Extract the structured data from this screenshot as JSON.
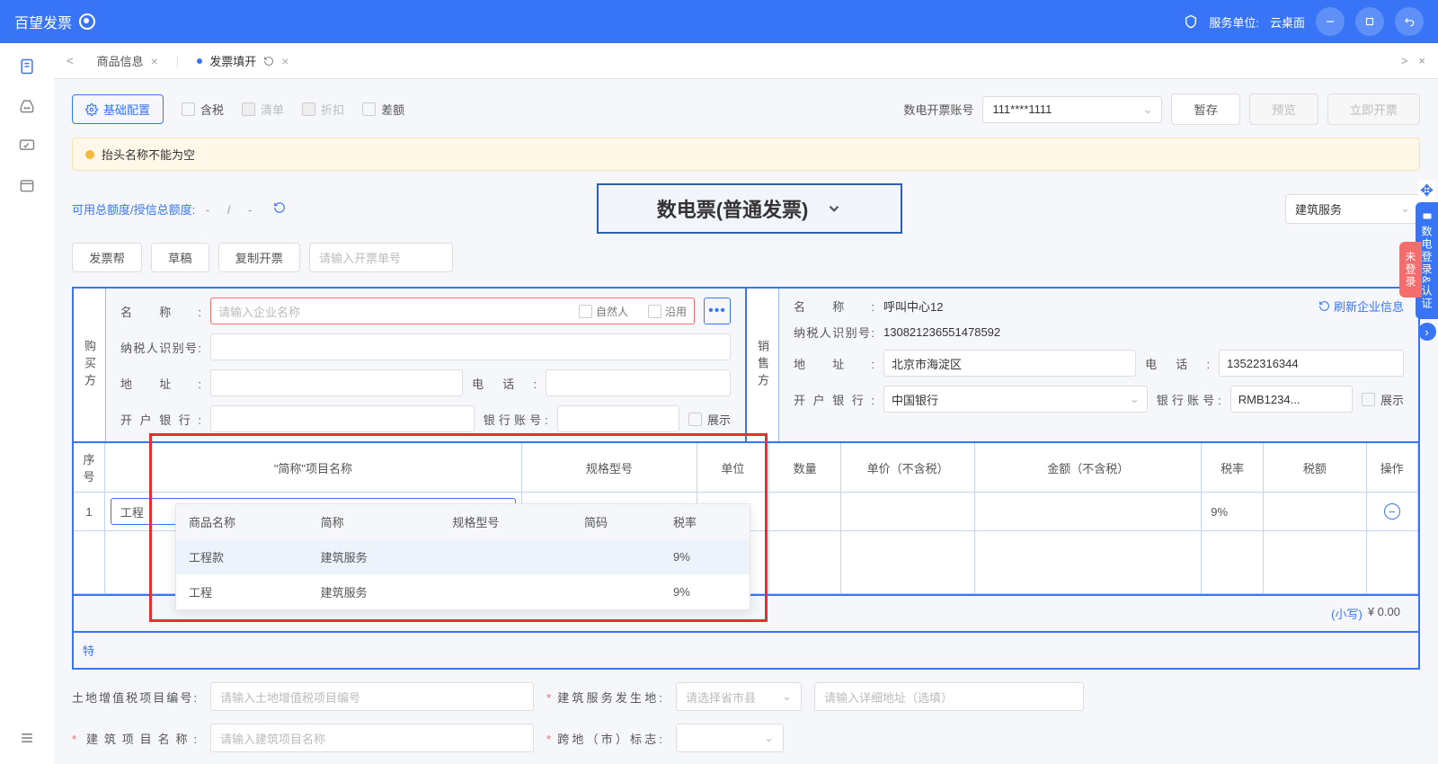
{
  "app": {
    "name": "百望发票",
    "service_unit_label": "服务单位:",
    "service_unit": "云桌面"
  },
  "tabs": [
    {
      "label": "商品信息",
      "active": false
    },
    {
      "label": "发票填开",
      "active": true
    }
  ],
  "toolbar": {
    "config": "基础配置",
    "tax_incl": "含税",
    "list": "清单",
    "discount": "折扣",
    "diff": "差额",
    "account_label": "数电开票账号",
    "account_value": "111****1111",
    "save": "暂存",
    "preview": "预览",
    "issue": "立即开票"
  },
  "warning": {
    "text": "抬头名称不能为空"
  },
  "quota": {
    "label": "可用总额度/授信总额度:",
    "v1": "-",
    "v2": "-"
  },
  "invoice_type": {
    "label": "数电票(普通发票)"
  },
  "category": {
    "value": "建筑服务"
  },
  "actions2": {
    "invoice_help": "发票帮",
    "draft": "草稿",
    "copy": "复制开票",
    "order_placeholder": "请输入开票单号"
  },
  "buyer": {
    "title": "购买方",
    "name_label": "名称:",
    "name_placeholder": "请输入企业名称",
    "natural": "自然人",
    "carry": "沿用",
    "tax_id_label": "纳税人识别号:",
    "address_label": "地址:",
    "phone_label": "电话:",
    "bank_label": "开户银行:",
    "bank_account_label": "银行账号:",
    "show": "展示"
  },
  "seller": {
    "title": "销售方",
    "name_label": "名称:",
    "name_value": "呼叫中心12",
    "refresh": "刷新企业信息",
    "tax_id_label": "纳税人识别号:",
    "tax_id_value": "130821236551478592",
    "address_label": "地址:",
    "address_value": "北京市海淀区",
    "phone_label": "电话:",
    "phone_value": "13522316344",
    "bank_label": "开户银行:",
    "bank_value": "中国银行",
    "bank_account_label": "银行账号:",
    "bank_account_value": "RMB1234...",
    "show": "展示"
  },
  "grid": {
    "headers": {
      "seq": "序号",
      "name": "\"简称\"项目名称",
      "spec": "规格型号",
      "unit": "单位",
      "qty": "数量",
      "price": "单价（不含税）",
      "amount": "金额（不含税）",
      "rate": "税率",
      "tax": "税额",
      "op": "操作"
    },
    "row": {
      "seq": "1",
      "name_input": "工程",
      "rate": "9%"
    },
    "totals": {
      "small": "(小写)",
      "value": "¥ 0.00"
    }
  },
  "dropdown": {
    "headers": {
      "name": "商品名称",
      "short": "简称",
      "spec": "规格型号",
      "code": "简码",
      "rate": "税率"
    },
    "rows": [
      {
        "name": "工程款",
        "short": "建筑服务",
        "spec": "",
        "code": "",
        "rate": "9%"
      },
      {
        "name": "工程",
        "short": "建筑服务",
        "spec": "",
        "code": "",
        "rate": "9%"
      }
    ]
  },
  "feature_prefix": "特",
  "extra": {
    "proj_code_label": "土地增值税项目编号:",
    "proj_code_placeholder": "请输入土地增值税项目编号",
    "service_loc_label": "建筑服务发生地:",
    "service_loc_placeholder": "请选择省市县",
    "detail_addr_placeholder": "请输入详细地址（选填）",
    "proj_name_label": "建筑项目名称:",
    "proj_name_placeholder": "请输入建筑项目名称",
    "cross_city_label": "跨地（市）标志:"
  },
  "side": {
    "badge1": "数电登录&认证",
    "badge2": "未登录"
  }
}
